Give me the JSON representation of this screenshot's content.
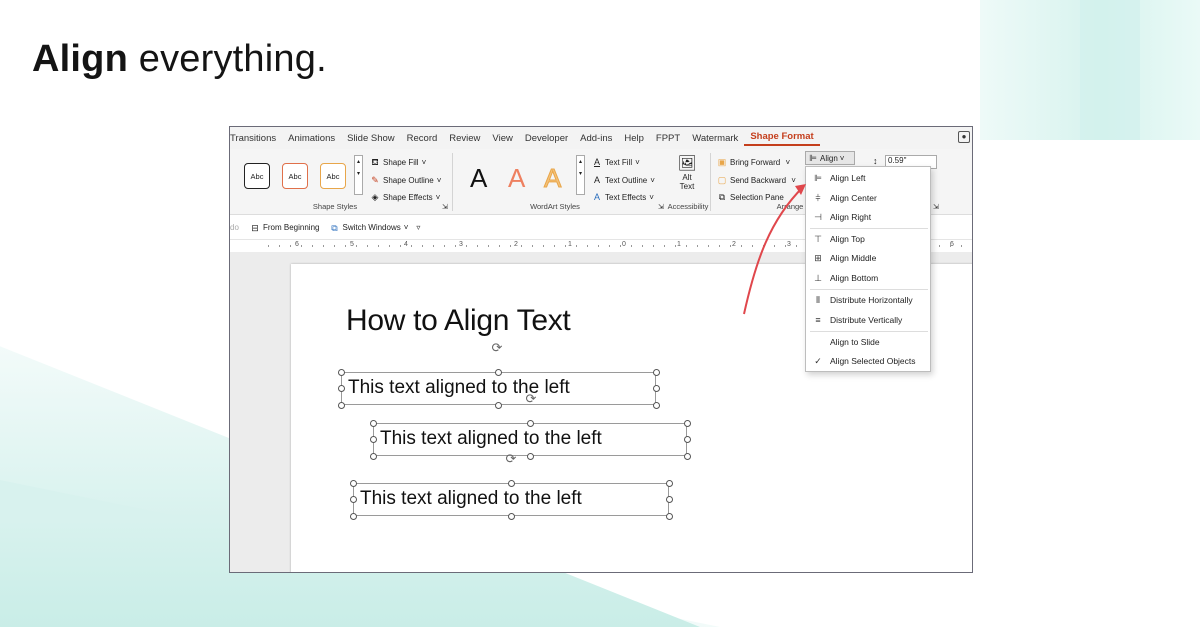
{
  "headline": {
    "bold": "Align",
    "rest": "everything."
  },
  "tabs": [
    "Transitions",
    "Animations",
    "Slide Show",
    "Record",
    "Review",
    "View",
    "Developer",
    "Add-ins",
    "Help",
    "FPPT",
    "Watermark",
    "Shape Format"
  ],
  "active_tab": "Shape Format",
  "ribbon": {
    "shape_styles": {
      "swatch_label": "Abc",
      "shape_fill": "Shape Fill",
      "shape_outline": "Shape Outline",
      "shape_effects": "Shape Effects",
      "group_label": "Shape Styles"
    },
    "wordart": {
      "letter": "A",
      "text_fill": "Text Fill",
      "text_outline": "Text Outline",
      "text_effects": "Text Effects",
      "group_label": "WordArt Styles"
    },
    "accessibility": {
      "alt_text_line1": "Alt",
      "alt_text_line2": "Text",
      "group_label": "Accessibility"
    },
    "arrange": {
      "bring_forward": "Bring Forward",
      "send_backward": "Send Backward",
      "selection_pane": "Selection Pane",
      "align": "Align",
      "group_label": "Arrange"
    },
    "size": {
      "height_value": "0.59\""
    }
  },
  "qat": {
    "from_beginning": "From Beginning",
    "switch_windows": "Switch Windows",
    "left_fragment": "do"
  },
  "ruler": {
    "numbers": [
      "6",
      "5",
      "4",
      "3",
      "2",
      "1",
      "0",
      "1",
      "2",
      "3",
      "6"
    ]
  },
  "slide": {
    "title": "How to Align Text",
    "text_boxes": [
      "This text aligned to the left",
      "This text aligned to the left",
      "This text aligned to the left"
    ]
  },
  "align_menu": {
    "items": [
      {
        "label": "Align Left",
        "icon": "align-left-icon",
        "glyph": "⊫"
      },
      {
        "label": "Align Center",
        "icon": "align-center-icon",
        "glyph": "⫩"
      },
      {
        "label": "Align Right",
        "icon": "align-right-icon",
        "glyph": "⊣"
      },
      {
        "label": "Align Top",
        "icon": "align-top-icon",
        "glyph": "⊤"
      },
      {
        "label": "Align Middle",
        "icon": "align-middle-icon",
        "glyph": "⊞"
      },
      {
        "label": "Align Bottom",
        "icon": "align-bottom-icon",
        "glyph": "⊥"
      },
      {
        "label": "Distribute Horizontally",
        "icon": "distribute-horizontal-icon",
        "glyph": "⫴"
      },
      {
        "label": "Distribute Vertically",
        "icon": "distribute-vertical-icon",
        "glyph": "≡"
      },
      {
        "label": "Align to Slide",
        "icon": "",
        "glyph": ""
      },
      {
        "label": "Align Selected Objects",
        "icon": "checkmark-icon",
        "glyph": "✓"
      }
    ]
  },
  "colors": {
    "accent": "#c43e1c",
    "arrow": "#e0474c",
    "bg_tint": "#d8f2ee"
  }
}
